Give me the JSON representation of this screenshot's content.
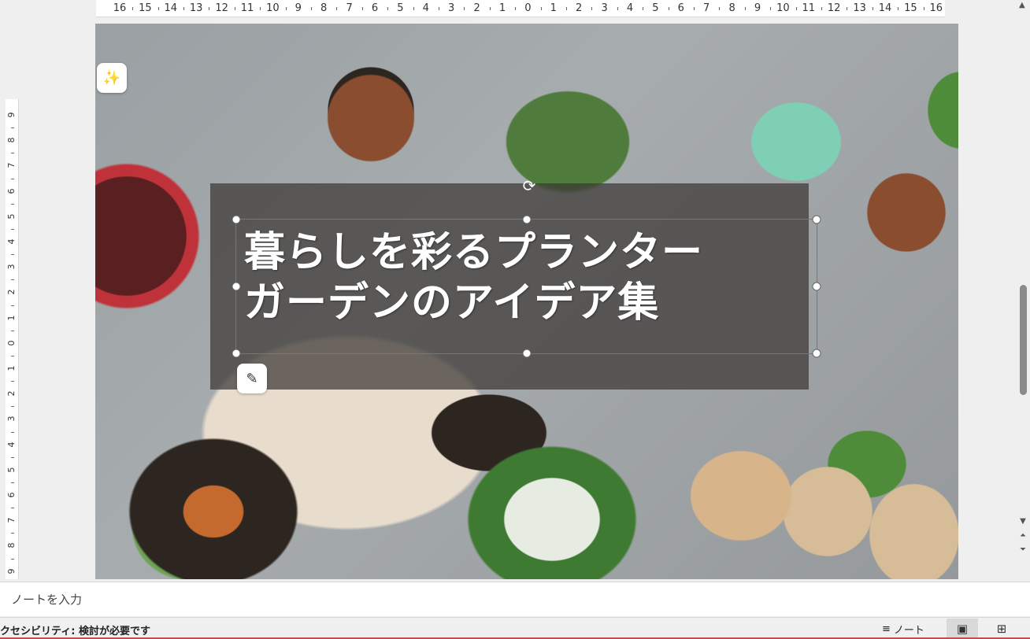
{
  "ruler": {
    "horizontal": [
      "16",
      "15",
      "14",
      "13",
      "12",
      "11",
      "10",
      "9",
      "8",
      "7",
      "6",
      "5",
      "4",
      "3",
      "2",
      "1",
      "0",
      "1",
      "2",
      "3",
      "4",
      "5",
      "6",
      "7",
      "8",
      "9",
      "10",
      "11",
      "12",
      "13",
      "14",
      "15",
      "16"
    ],
    "vertical": [
      "9",
      "8",
      "7",
      "6",
      "5",
      "4",
      "3",
      "2",
      "1",
      "0",
      "1",
      "2",
      "3",
      "4",
      "5",
      "6",
      "7",
      "8",
      "9"
    ]
  },
  "slide": {
    "title_line1": "暮らしを彩るプランター",
    "title_line2": "ガーデンのアイデア集"
  },
  "icons": {
    "designer": "sparkle-icon",
    "rewrite": "magic-pen-icon",
    "rotate": "rotate-icon"
  },
  "notes": {
    "placeholder": "ノートを入力"
  },
  "status": {
    "accessibility": "クセシビリティ: 検討が必要です",
    "notes_button": "ノート"
  },
  "colors": {
    "accent_bar": "#c0504d",
    "selected_view": "#d9d9d9"
  }
}
